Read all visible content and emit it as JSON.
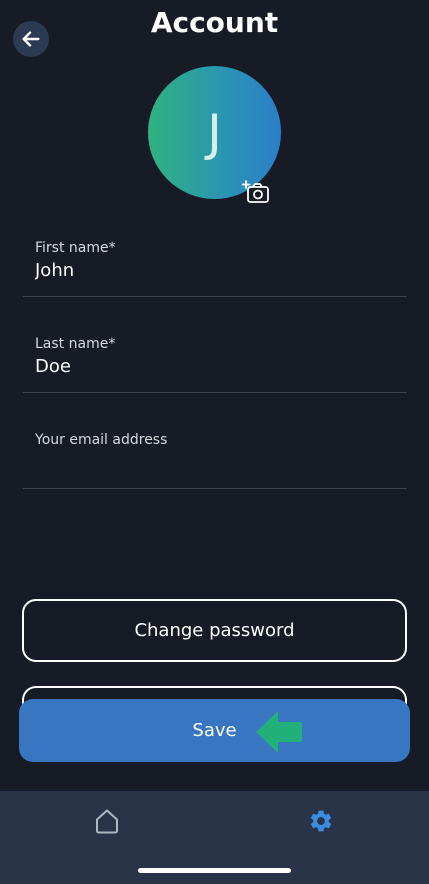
{
  "header": {
    "title": "Account",
    "back_icon": "arrow-left-icon"
  },
  "profile": {
    "initial": "J",
    "camera_icon": "add-photo-icon"
  },
  "form": {
    "first_name": {
      "label": "First name*",
      "value": "John"
    },
    "last_name": {
      "label": "Last name*",
      "value": "Doe"
    },
    "email": {
      "label": "Your email address",
      "value": ""
    }
  },
  "actions": {
    "change_password": "Change password",
    "save": "Save"
  },
  "tabbar": {
    "home_icon": "home-icon",
    "settings_icon": "gear-icon"
  },
  "colors": {
    "background": "#161b26",
    "primary": "#3876c2",
    "accent_green": "#21b07a",
    "tabbar": "#293448"
  }
}
